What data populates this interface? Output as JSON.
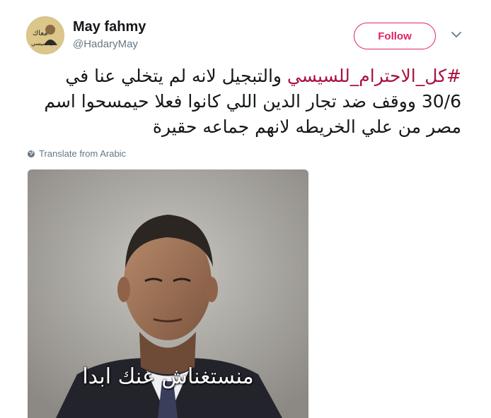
{
  "user": {
    "name": "May fahmy",
    "handle": "@HadaryMay",
    "avatar_text": "معاك يا سيسي"
  },
  "follow_label": "Follow",
  "tweet": {
    "hashtag": "#كل_الاحترام_للسيسي",
    "text": " والتبجيل لانه لم يتخلي عنا في 30/6 ووقف ضد تجار الدين اللي كانوا فعلا حيمسحوا اسم مصر من علي الخريطه لانهم جماعه حقيرة"
  },
  "translate_label": "Translate from Arabic",
  "image": {
    "caption": "منستغناش عنك ابدا"
  },
  "colors": {
    "accent": "#e0245e",
    "hashtag": "#a8123e",
    "muted": "#657786",
    "text": "#14171a"
  },
  "icons": {
    "chevron": "chevron-down-icon",
    "globe": "globe-icon"
  }
}
